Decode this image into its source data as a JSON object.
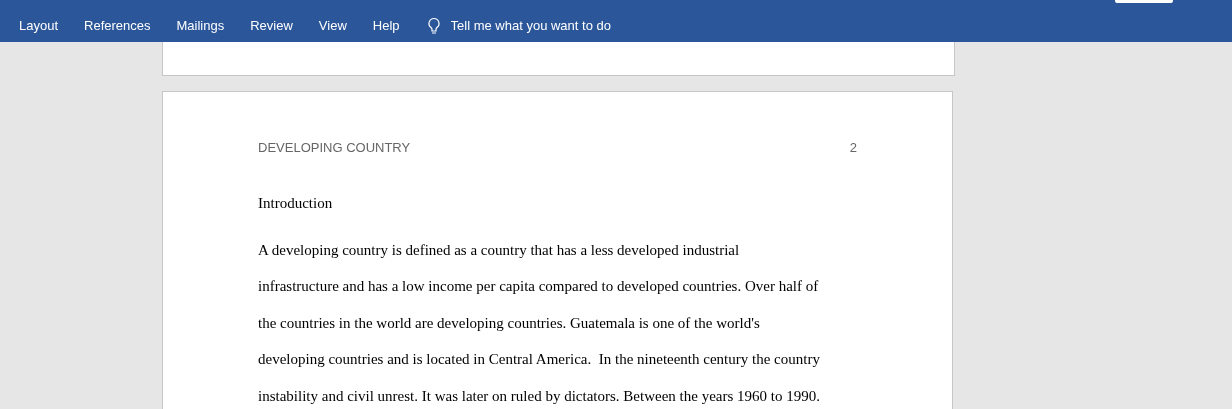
{
  "ribbon": {
    "tabs": [
      {
        "label": "Layout"
      },
      {
        "label": "References"
      },
      {
        "label": "Mailings"
      },
      {
        "label": "Review"
      },
      {
        "label": "View"
      },
      {
        "label": "Help"
      }
    ],
    "tell_me": {
      "placeholder": "Tell me what you want to do"
    }
  },
  "document": {
    "header": {
      "title": "DEVELOPING COUNTRY",
      "page_number": "2"
    },
    "heading": "Introduction",
    "paragraph_lines": [
      "A developing country is defined as a country that has a less developed industrial",
      "infrastructure and has a low income per capita compared to developed countries. Over half of",
      "the countries in the world are developing countries. Guatemala is one of the world's",
      "developing countries and is located in Central America.  In the nineteenth century the country",
      "instability and civil unrest. It was later on ruled by dictators. Between the years 1960 to 1990."
    ]
  }
}
